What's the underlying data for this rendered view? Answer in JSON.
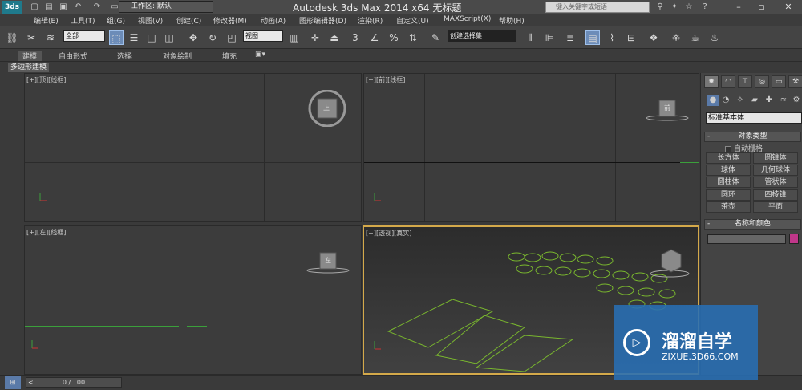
{
  "titlebar": {
    "workspace": "工作区: 默认",
    "app_title": "Autodesk 3ds Max  2014 x64    无标题",
    "search_placeholder": "键入关键字或短语"
  },
  "menu": [
    "编辑(E)",
    "工具(T)",
    "组(G)",
    "视图(V)",
    "创建(C)",
    "修改器(M)",
    "动画(A)",
    "图形编辑器(D)",
    "渲染(R)",
    "自定义(U)",
    "MAXScript(X)",
    "帮助(H)"
  ],
  "toolbar": {
    "selection_filter": "全部",
    "reference_coord": "视图",
    "named_selection": "创建选择集",
    "snap_label": "3"
  },
  "ribbon": {
    "tabs": [
      "建模",
      "自由形式",
      "选择",
      "对象绘制",
      "填充"
    ],
    "sub_label": "多边形建模"
  },
  "viewports": {
    "top": {
      "label": "[+][顶][线框]",
      "cube": "上"
    },
    "front": {
      "label": "[+][前][线框]",
      "cube": "前"
    },
    "left": {
      "label": "[+][左][线框]",
      "cube": "左"
    },
    "perspective": {
      "label": "[+][透视][真实]"
    }
  },
  "command_panel": {
    "category": "标准基本体",
    "object_type_title": "对象类型",
    "autogrid": "自动栅格",
    "objects": [
      "长方体",
      "圆锥体",
      "球体",
      "几何球体",
      "圆柱体",
      "管状体",
      "圆环",
      "四棱锥",
      "茶壶",
      "平面"
    ],
    "name_color_title": "名称和颜色",
    "object_color": "#c0378a"
  },
  "timeline": {
    "frame": "0 / 100"
  },
  "watermark": {
    "title": "溜溜自学",
    "url": "ZIXUE.3D66.COM"
  }
}
